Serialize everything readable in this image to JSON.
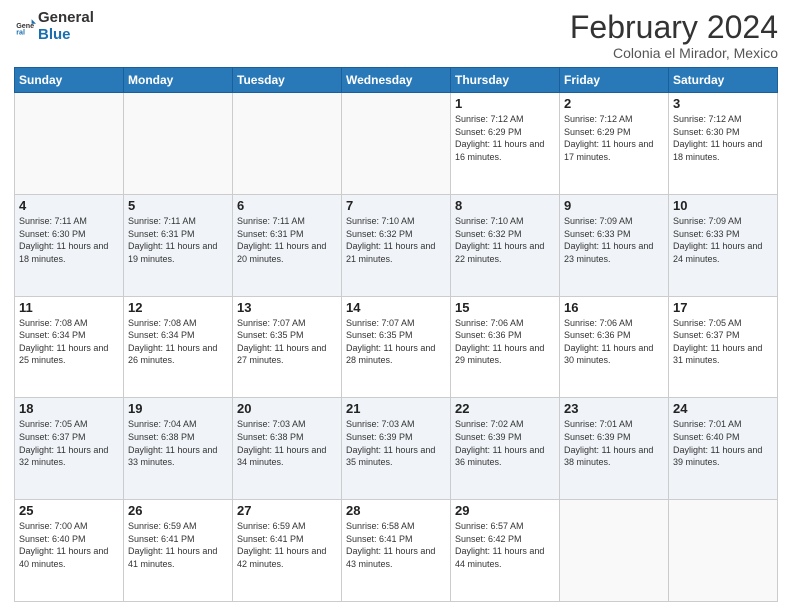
{
  "logo": {
    "line1": "General",
    "line2": "Blue"
  },
  "title": "February 2024",
  "subtitle": "Colonia el Mirador, Mexico",
  "days_of_week": [
    "Sunday",
    "Monday",
    "Tuesday",
    "Wednesday",
    "Thursday",
    "Friday",
    "Saturday"
  ],
  "weeks": [
    [
      {
        "day": "",
        "info": ""
      },
      {
        "day": "",
        "info": ""
      },
      {
        "day": "",
        "info": ""
      },
      {
        "day": "",
        "info": ""
      },
      {
        "day": "1",
        "info": "Sunrise: 7:12 AM\nSunset: 6:29 PM\nDaylight: 11 hours and 16 minutes."
      },
      {
        "day": "2",
        "info": "Sunrise: 7:12 AM\nSunset: 6:29 PM\nDaylight: 11 hours and 17 minutes."
      },
      {
        "day": "3",
        "info": "Sunrise: 7:12 AM\nSunset: 6:30 PM\nDaylight: 11 hours and 18 minutes."
      }
    ],
    [
      {
        "day": "4",
        "info": "Sunrise: 7:11 AM\nSunset: 6:30 PM\nDaylight: 11 hours and 18 minutes."
      },
      {
        "day": "5",
        "info": "Sunrise: 7:11 AM\nSunset: 6:31 PM\nDaylight: 11 hours and 19 minutes."
      },
      {
        "day": "6",
        "info": "Sunrise: 7:11 AM\nSunset: 6:31 PM\nDaylight: 11 hours and 20 minutes."
      },
      {
        "day": "7",
        "info": "Sunrise: 7:10 AM\nSunset: 6:32 PM\nDaylight: 11 hours and 21 minutes."
      },
      {
        "day": "8",
        "info": "Sunrise: 7:10 AM\nSunset: 6:32 PM\nDaylight: 11 hours and 22 minutes."
      },
      {
        "day": "9",
        "info": "Sunrise: 7:09 AM\nSunset: 6:33 PM\nDaylight: 11 hours and 23 minutes."
      },
      {
        "day": "10",
        "info": "Sunrise: 7:09 AM\nSunset: 6:33 PM\nDaylight: 11 hours and 24 minutes."
      }
    ],
    [
      {
        "day": "11",
        "info": "Sunrise: 7:08 AM\nSunset: 6:34 PM\nDaylight: 11 hours and 25 minutes."
      },
      {
        "day": "12",
        "info": "Sunrise: 7:08 AM\nSunset: 6:34 PM\nDaylight: 11 hours and 26 minutes."
      },
      {
        "day": "13",
        "info": "Sunrise: 7:07 AM\nSunset: 6:35 PM\nDaylight: 11 hours and 27 minutes."
      },
      {
        "day": "14",
        "info": "Sunrise: 7:07 AM\nSunset: 6:35 PM\nDaylight: 11 hours and 28 minutes."
      },
      {
        "day": "15",
        "info": "Sunrise: 7:06 AM\nSunset: 6:36 PM\nDaylight: 11 hours and 29 minutes."
      },
      {
        "day": "16",
        "info": "Sunrise: 7:06 AM\nSunset: 6:36 PM\nDaylight: 11 hours and 30 minutes."
      },
      {
        "day": "17",
        "info": "Sunrise: 7:05 AM\nSunset: 6:37 PM\nDaylight: 11 hours and 31 minutes."
      }
    ],
    [
      {
        "day": "18",
        "info": "Sunrise: 7:05 AM\nSunset: 6:37 PM\nDaylight: 11 hours and 32 minutes."
      },
      {
        "day": "19",
        "info": "Sunrise: 7:04 AM\nSunset: 6:38 PM\nDaylight: 11 hours and 33 minutes."
      },
      {
        "day": "20",
        "info": "Sunrise: 7:03 AM\nSunset: 6:38 PM\nDaylight: 11 hours and 34 minutes."
      },
      {
        "day": "21",
        "info": "Sunrise: 7:03 AM\nSunset: 6:39 PM\nDaylight: 11 hours and 35 minutes."
      },
      {
        "day": "22",
        "info": "Sunrise: 7:02 AM\nSunset: 6:39 PM\nDaylight: 11 hours and 36 minutes."
      },
      {
        "day": "23",
        "info": "Sunrise: 7:01 AM\nSunset: 6:39 PM\nDaylight: 11 hours and 38 minutes."
      },
      {
        "day": "24",
        "info": "Sunrise: 7:01 AM\nSunset: 6:40 PM\nDaylight: 11 hours and 39 minutes."
      }
    ],
    [
      {
        "day": "25",
        "info": "Sunrise: 7:00 AM\nSunset: 6:40 PM\nDaylight: 11 hours and 40 minutes."
      },
      {
        "day": "26",
        "info": "Sunrise: 6:59 AM\nSunset: 6:41 PM\nDaylight: 11 hours and 41 minutes."
      },
      {
        "day": "27",
        "info": "Sunrise: 6:59 AM\nSunset: 6:41 PM\nDaylight: 11 hours and 42 minutes."
      },
      {
        "day": "28",
        "info": "Sunrise: 6:58 AM\nSunset: 6:41 PM\nDaylight: 11 hours and 43 minutes."
      },
      {
        "day": "29",
        "info": "Sunrise: 6:57 AM\nSunset: 6:42 PM\nDaylight: 11 hours and 44 minutes."
      },
      {
        "day": "",
        "info": ""
      },
      {
        "day": "",
        "info": ""
      }
    ]
  ]
}
